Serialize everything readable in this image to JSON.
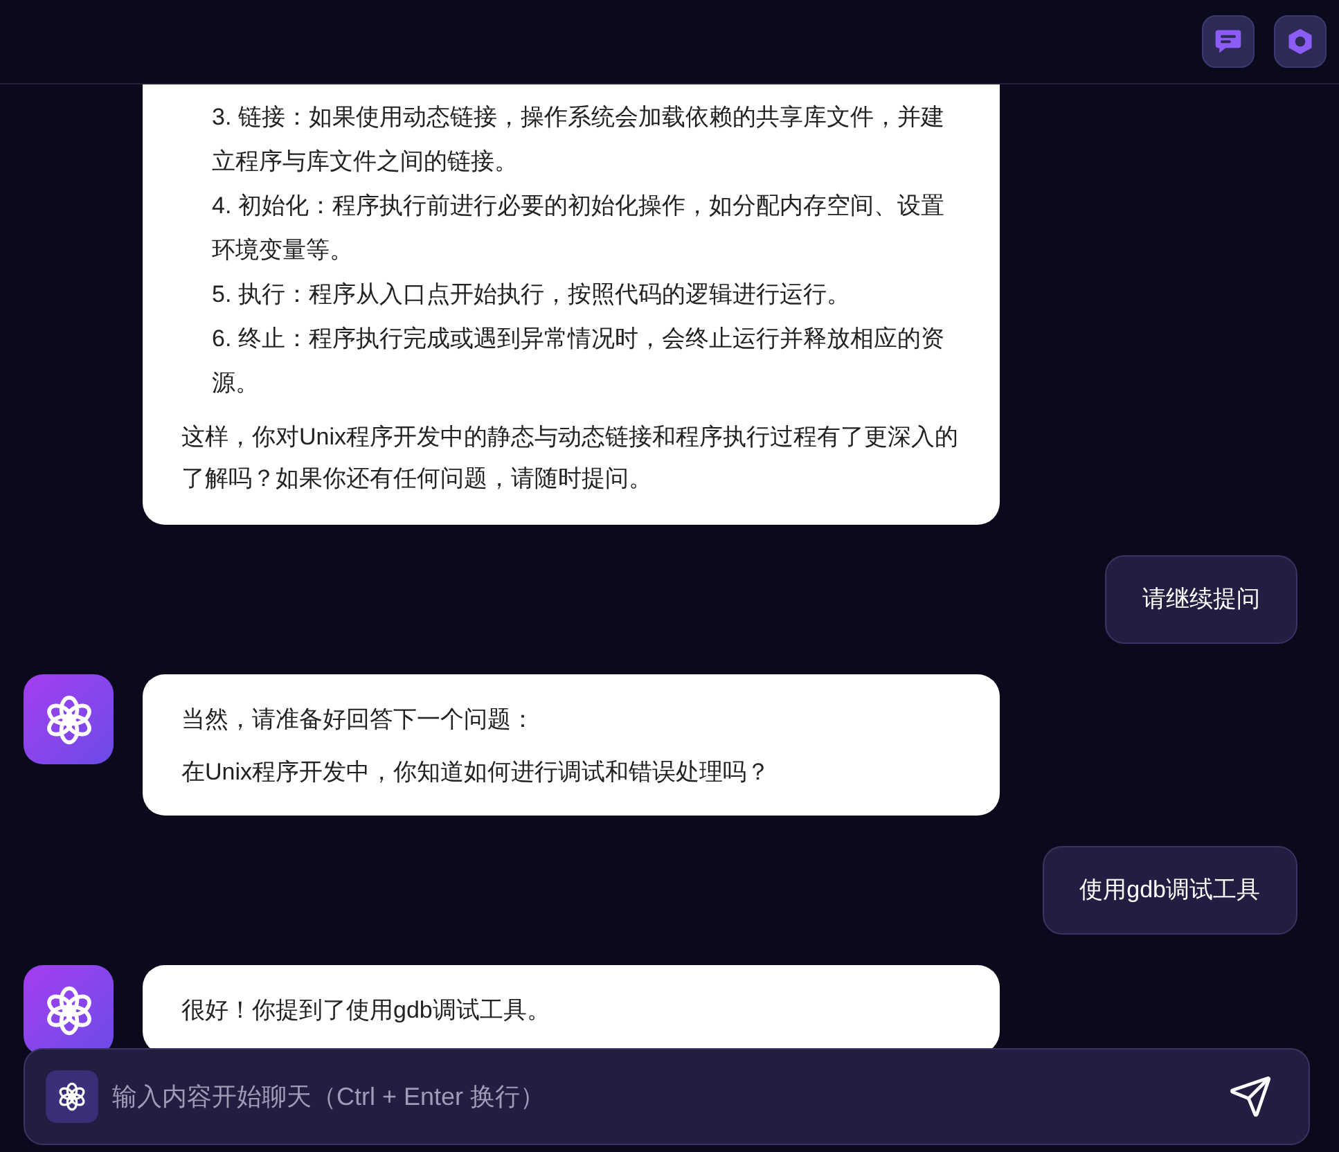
{
  "header": {
    "buttons": [
      {
        "kind": "chat"
      },
      {
        "kind": "hexagon"
      }
    ]
  },
  "messages": [
    {
      "kind": "assistant",
      "avatar_visible": false,
      "blocks": [
        {
          "kind": "list_item",
          "text": "3. 链接：如果使用动态链接，操作系统会加载依赖的共享库文件，并建立程序与库文件之间的链接。"
        },
        {
          "kind": "list_item",
          "text": "4. 初始化：程序执行前进行必要的初始化操作，如分配内存空间、设置环境变量等。"
        },
        {
          "kind": "list_item",
          "text": "5. 执行：程序从入口点开始执行，按照代码的逻辑进行运行。"
        },
        {
          "kind": "list_item",
          "text": "6. 终止：程序执行完成或遇到异常情况时，会终止运行并释放相应的资源。"
        },
        {
          "kind": "paragraph",
          "text": "这样，你对Unix程序开发中的静态与动态链接和程序执行过程有了更深入的了解吗？如果你还有任何问题，请随时提问。"
        }
      ]
    },
    {
      "kind": "user",
      "text": "请继续提问"
    },
    {
      "kind": "assistant",
      "avatar_visible": true,
      "blocks": [
        {
          "kind": "paragraph",
          "text": "当然，请准备好回答下一个问题："
        },
        {
          "kind": "paragraph",
          "text": "在Unix程序开发中，你知道如何进行调试和错误处理吗？"
        }
      ]
    },
    {
      "kind": "user",
      "text": "使用gdb调试工具"
    },
    {
      "kind": "assistant",
      "avatar_visible": true,
      "blocks": [
        {
          "kind": "paragraph",
          "text": "很好！你提到了使用gdb调试工具。"
        }
      ]
    }
  ],
  "composer": {
    "placeholder": "输入内容开始聊天（Ctrl + Enter 换行）"
  }
}
